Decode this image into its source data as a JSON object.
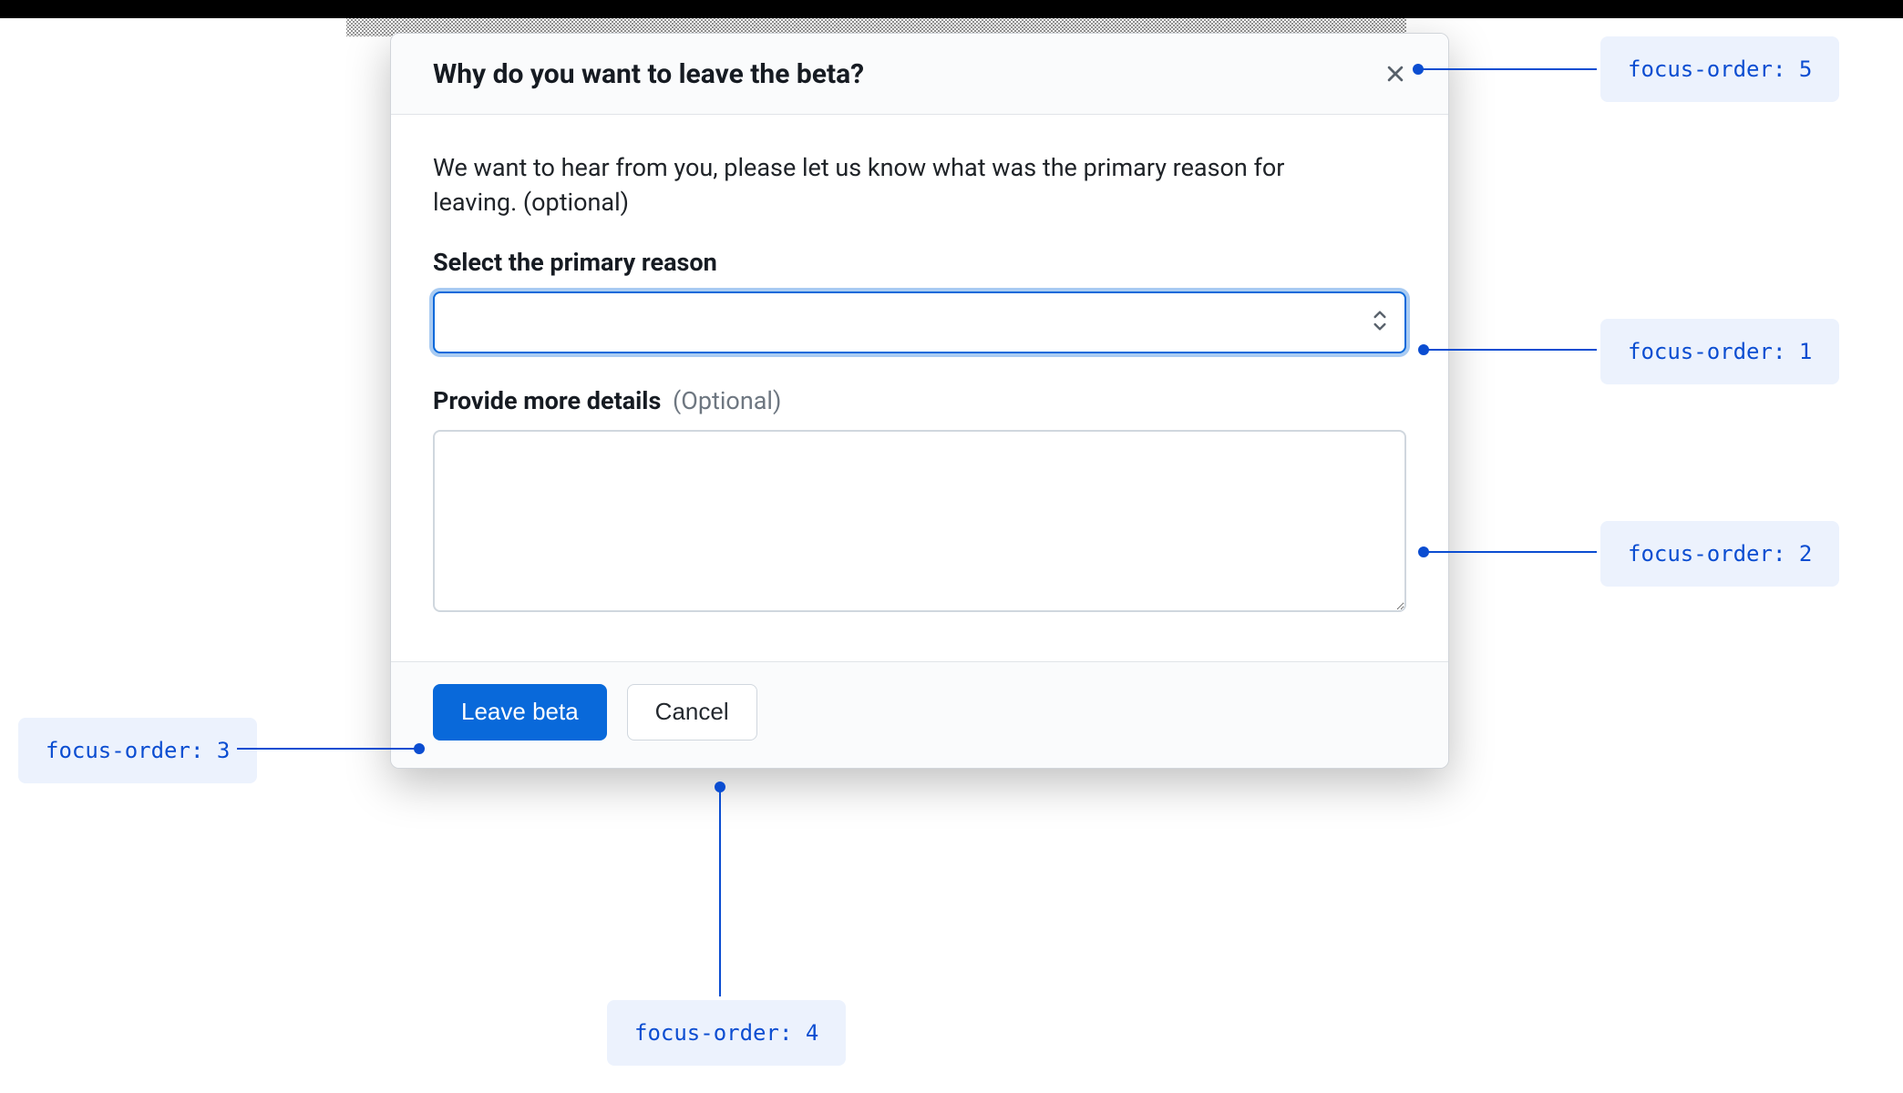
{
  "dialog": {
    "title": "Why do you want to leave the beta?",
    "intro": "We want to hear from you, please let us know what was the primary reason for leaving. (optional)",
    "reason_label": "Select the primary reason",
    "details_label": "Provide more details",
    "details_optional": "(Optional)",
    "reason_value": "",
    "details_value": ""
  },
  "buttons": {
    "primary": "Leave beta",
    "secondary": "Cancel"
  },
  "annotations": {
    "fo1": "focus-order: 1",
    "fo2": "focus-order: 2",
    "fo3": "focus-order: 3",
    "fo4": "focus-order: 4",
    "fo5": "focus-order: 5"
  },
  "colors": {
    "accent": "#0969da",
    "annotation_bg": "#ecf2fd",
    "annotation_text": "#0b4dd1"
  }
}
